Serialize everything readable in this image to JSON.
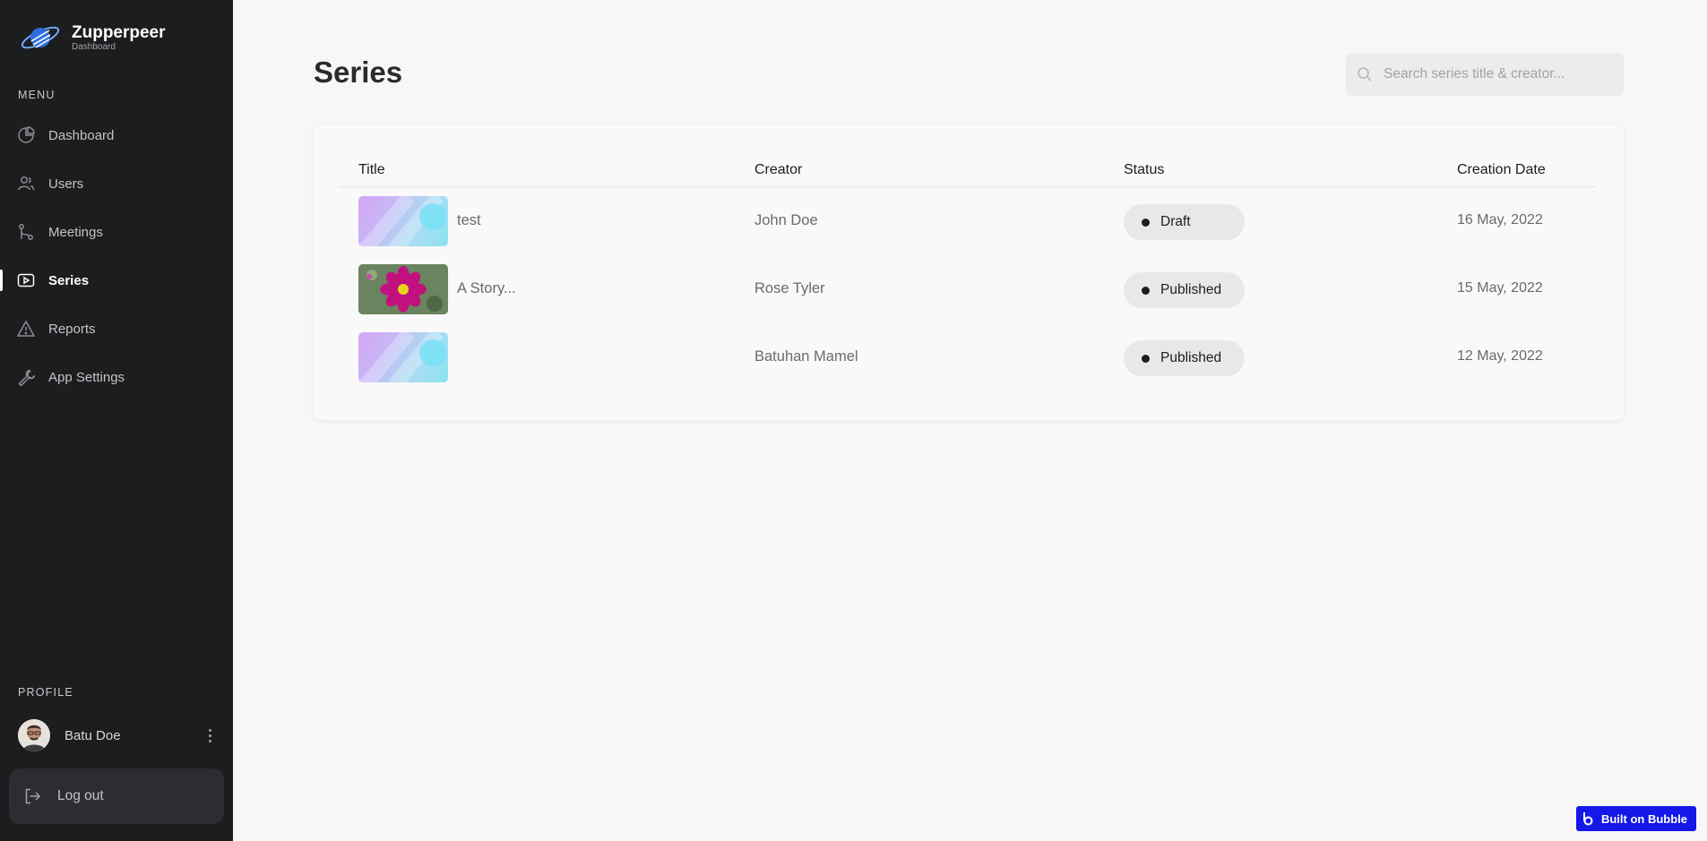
{
  "brand": {
    "name": "Zupperpeer",
    "subtitle": "Dashboard"
  },
  "sidebar": {
    "menu_label": "MENU",
    "items": [
      {
        "label": "Dashboard",
        "icon": "pie-chart-icon",
        "active": false
      },
      {
        "label": "Users",
        "icon": "users-icon",
        "active": false
      },
      {
        "label": "Meetings",
        "icon": "git-branch-icon",
        "active": false
      },
      {
        "label": "Series",
        "icon": "play-video-icon",
        "active": true
      },
      {
        "label": "Reports",
        "icon": "warning-triangle-icon",
        "active": false
      },
      {
        "label": "App Settings",
        "icon": "wrench-icon",
        "active": false
      }
    ],
    "profile_label": "PROFILE",
    "profile": {
      "name": "Batu Doe"
    },
    "logout_label": "Log out"
  },
  "main": {
    "title": "Series",
    "search": {
      "placeholder": "Search series title & creator...",
      "value": ""
    },
    "table": {
      "columns": [
        "Title",
        "Creator",
        "Status",
        "Creation Date"
      ],
      "rows": [
        {
          "title": "test",
          "creator": "John Doe",
          "status": "Draft",
          "date": "16 May, 2022",
          "thumb": "gradient"
        },
        {
          "title": "A Story...",
          "creator": "Rose Tyler",
          "status": "Published",
          "date": "15 May, 2022",
          "thumb": "flower"
        },
        {
          "title": "",
          "creator": "Batuhan Mamel",
          "status": "Published",
          "date": "12 May, 2022",
          "thumb": "gradient"
        }
      ]
    }
  },
  "badge": {
    "label": "Built on Bubble"
  },
  "colors": {
    "sidebar_bg": "#1c1d1f",
    "page_bg": "#f7f7f7",
    "status_pill_bg": "#e8e8e9",
    "bubble_blue": "#1418e8"
  }
}
